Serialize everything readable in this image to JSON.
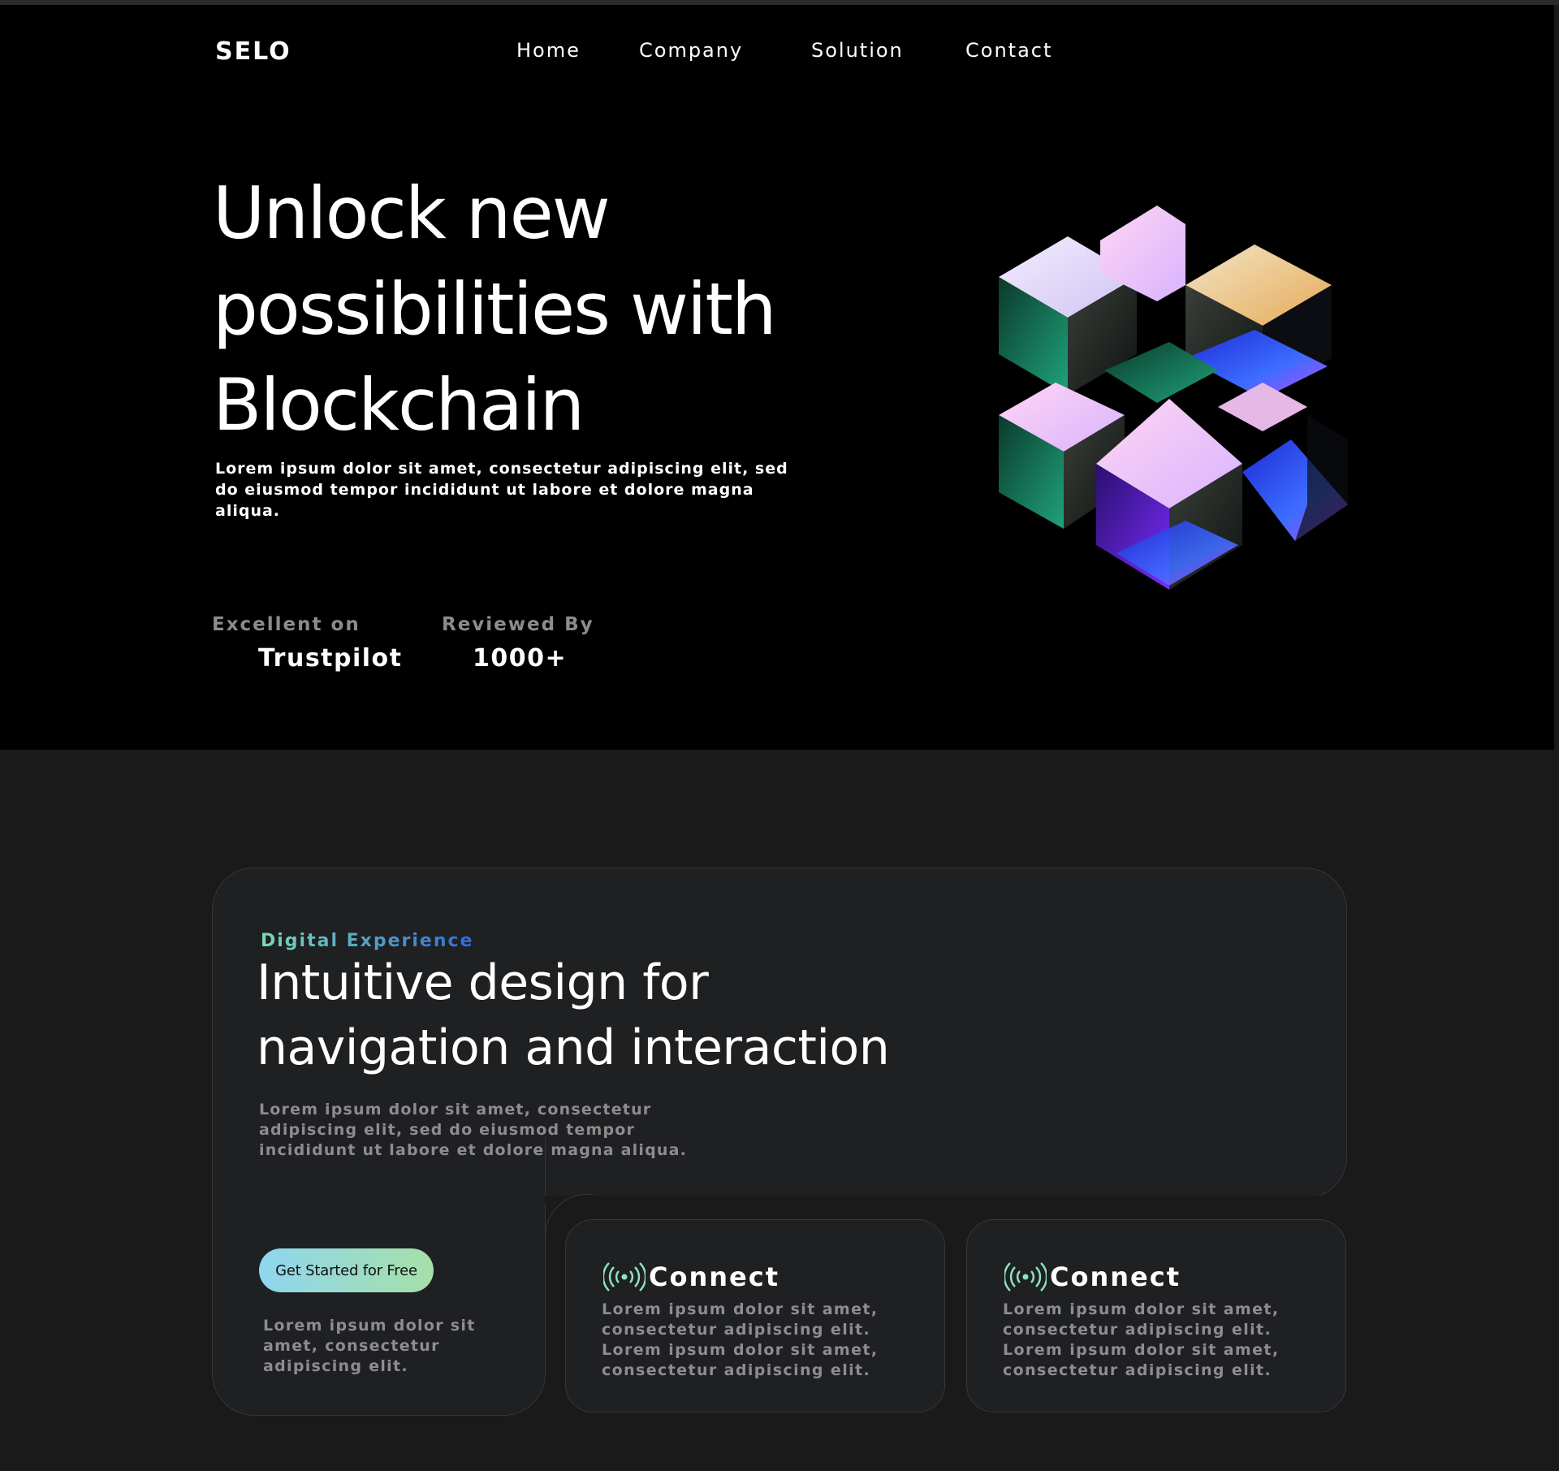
{
  "brand": {
    "logo": "SELO"
  },
  "nav": {
    "items": [
      "Home",
      "Company",
      "Solution",
      "Contact"
    ]
  },
  "hero": {
    "title_lines": [
      "Unlock new",
      "possibilities with",
      "Blockchain"
    ],
    "subtitle": "Lorem ipsum dolor sit amet, consectetur adipiscing elit, sed do eiusmod tempor incididunt ut labore et dolore magna aliqua.",
    "stats": [
      {
        "label": "Excellent on",
        "value": "Trustpilot"
      },
      {
        "label": "Reviewed By",
        "value": "1000+"
      }
    ],
    "graphic": "iridescent-cube-cluster"
  },
  "features": {
    "eyebrow": "Digital Experience",
    "title_lines": [
      "Intuitive design for",
      "navigation and interaction"
    ],
    "body": "Lorem ipsum dolor sit amet, consectetur adipiscing elit, sed do eiusmod tempor incididunt ut labore et dolore magna aliqua.",
    "cta_label": "Get Started for Free",
    "cta_note": "Lorem ipsum dolor sit amet, consectetur adipiscing elit.",
    "cards": [
      {
        "icon": "broadcast-icon",
        "title": "Connect",
        "body": "Lorem ipsum dolor sit amet, consectetur adipiscing elit. Lorem ipsum dolor sit amet, consectetur adipiscing elit."
      },
      {
        "icon": "broadcast-icon",
        "title": "Connect",
        "body": "Lorem ipsum dolor sit amet, consectetur adipiscing elit. Lorem ipsum dolor sit amet, consectetur adipiscing elit."
      }
    ]
  },
  "colors": {
    "hero_bg": "#000000",
    "page_bg": "#1a1a1b",
    "panel_bg": "#1f2022",
    "accent_gradient": [
      "#7bd9b4",
      "#2f6bd8"
    ],
    "cta_gradient": [
      "#8fd6ef",
      "#a6e0a8"
    ],
    "icon_color": "#8fe0c4"
  }
}
